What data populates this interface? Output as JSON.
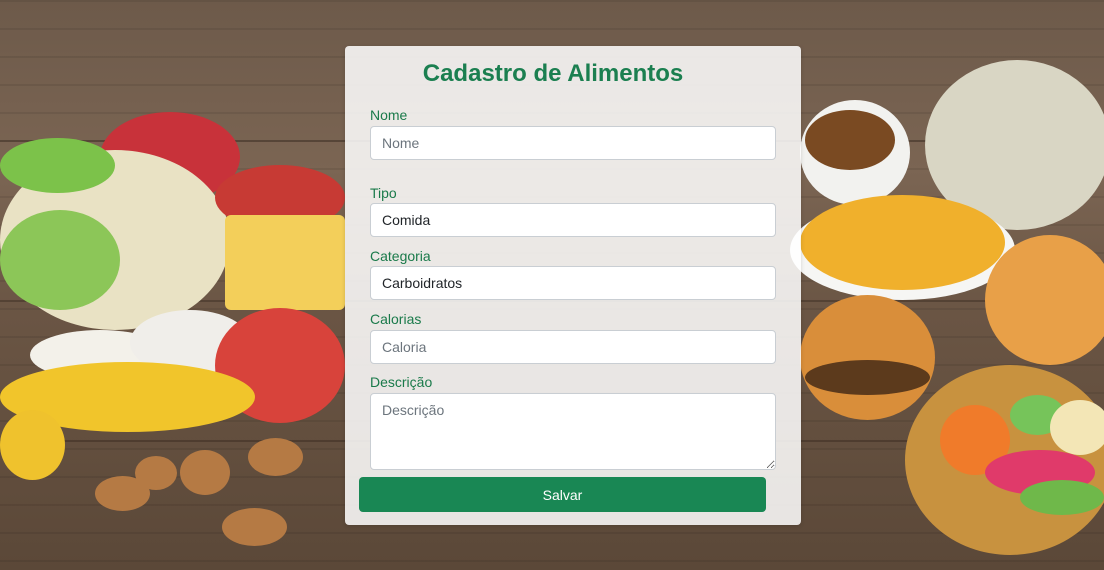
{
  "form": {
    "title": "Cadastro de Alimentos",
    "nome": {
      "label": "Nome",
      "placeholder": "Nome",
      "value": ""
    },
    "tipo": {
      "label": "Tipo",
      "value": "Comida"
    },
    "categoria": {
      "label": "Categoria",
      "value": "Carboidratos"
    },
    "calorias": {
      "label": "Calorias",
      "placeholder": "Caloria",
      "value": ""
    },
    "descricao": {
      "label": "Descrição",
      "placeholder": "Descrição",
      "value": ""
    },
    "save_label": "Salvar"
  },
  "colors": {
    "accent": "#198754",
    "label": "#1a7a4a",
    "title": "#1b7f50"
  }
}
